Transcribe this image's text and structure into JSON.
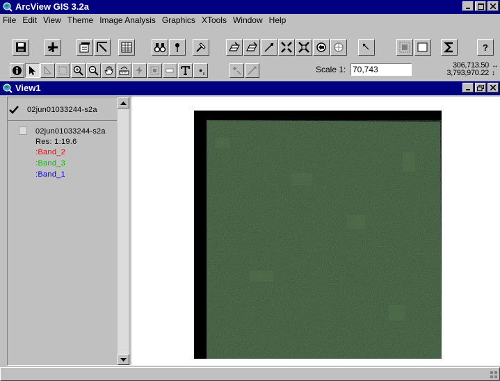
{
  "app": {
    "title": "ArcView GIS 3.2a"
  },
  "window_buttons": {
    "minimize": "_",
    "maximize": "□",
    "close": "×",
    "restore": "▫"
  },
  "menu": [
    "File",
    "Edit",
    "View",
    "Theme",
    "Image Analysis",
    "Graphics",
    "XTools",
    "Window",
    "Help"
  ],
  "toolbar": {
    "scale_label": "Scale 1:",
    "scale_value": "70,743"
  },
  "coordinates": {
    "x": "306,713.50",
    "y": "3,793,970.22",
    "x_arrow": "↔",
    "y_arrow": "↕"
  },
  "view": {
    "title": "View1"
  },
  "toc": {
    "themes": [
      {
        "name": "02jun01033244-s2a",
        "checked": true
      },
      {
        "name": "02jun01033244-s2a",
        "checked": false,
        "res": "Res: 1:19.6",
        "bands": [
          {
            "label": ":Band_2",
            "color": "#ff0000"
          },
          {
            "label": ":Band_3",
            "color": "#00c000"
          },
          {
            "label": ":Band_1",
            "color": "#0000ff"
          }
        ]
      }
    ]
  },
  "colors": {
    "titlebar": "#000080",
    "chrome": "#c0c0c0",
    "imagery": "#2e4a2c"
  }
}
